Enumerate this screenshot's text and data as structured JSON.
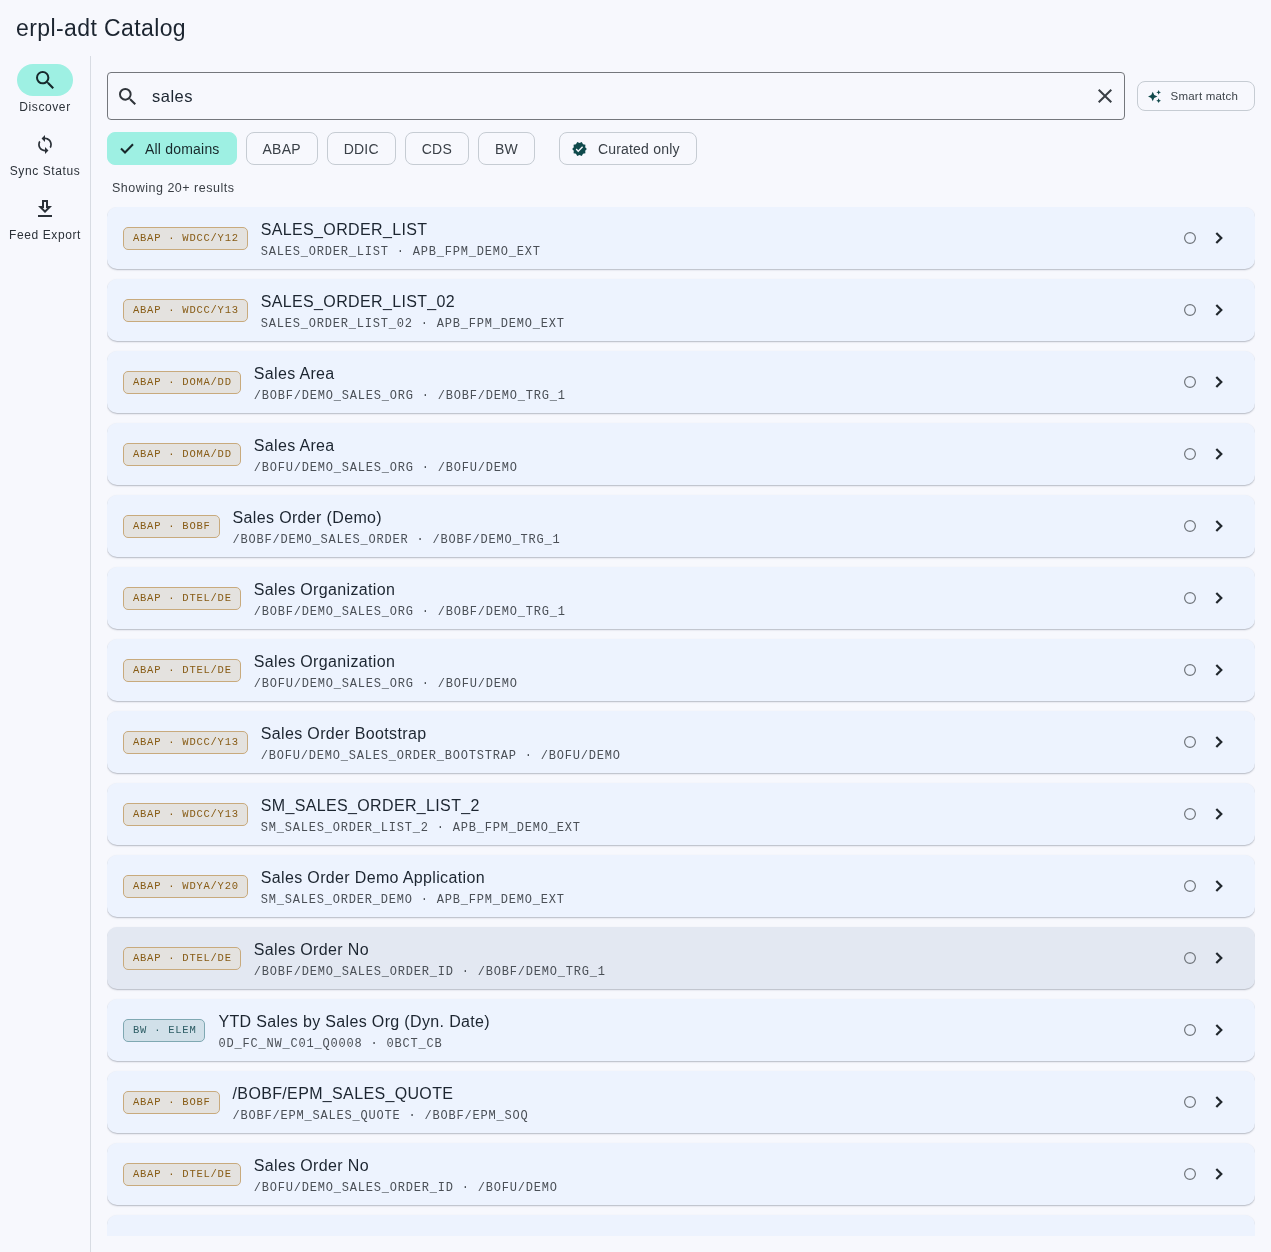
{
  "app": {
    "title": "erpl-adt Catalog"
  },
  "nav": [
    {
      "label": "Discover",
      "selected": true
    },
    {
      "label": "Sync Status",
      "selected": false
    },
    {
      "label": "Feed Export",
      "selected": false
    }
  ],
  "search": {
    "value": "sales"
  },
  "smart_match": {
    "label": "Smart match"
  },
  "filters": [
    {
      "label": "All domains",
      "selected": true
    },
    {
      "label": "ABAP",
      "selected": false
    },
    {
      "label": "DDIC",
      "selected": false
    },
    {
      "label": "CDS",
      "selected": false
    },
    {
      "label": "BW",
      "selected": false
    }
  ],
  "curated": {
    "label": "Curated only",
    "on": false
  },
  "result_count": "Showing 20+ results",
  "results": [
    {
      "badge": {
        "text": "ABAP · WDCC/Y12",
        "kind": "abap"
      },
      "title": "SALES_ORDER_LIST",
      "subtitle": "SALES_ORDER_LIST · APB_FPM_DEMO_EXT",
      "highlighted": false
    },
    {
      "badge": {
        "text": "ABAP · WDCC/Y13",
        "kind": "abap"
      },
      "title": "SALES_ORDER_LIST_02",
      "subtitle": "SALES_ORDER_LIST_02 · APB_FPM_DEMO_EXT",
      "highlighted": false
    },
    {
      "badge": {
        "text": "ABAP · DOMA/DD",
        "kind": "abap"
      },
      "title": "Sales Area",
      "subtitle": "/BOBF/DEMO_SALES_ORG · /BOBF/DEMO_TRG_1",
      "highlighted": false
    },
    {
      "badge": {
        "text": "ABAP · DOMA/DD",
        "kind": "abap"
      },
      "title": "Sales Area",
      "subtitle": "/BOFU/DEMO_SALES_ORG · /BOFU/DEMO",
      "highlighted": false
    },
    {
      "badge": {
        "text": "ABAP · BOBF",
        "kind": "abap"
      },
      "title": "Sales Order (Demo)",
      "subtitle": "/BOBF/DEMO_SALES_ORDER · /BOBF/DEMO_TRG_1",
      "highlighted": false
    },
    {
      "badge": {
        "text": "ABAP · DTEL/DE",
        "kind": "abap"
      },
      "title": "Sales Organization",
      "subtitle": "/BOBF/DEMO_SALES_ORG · /BOBF/DEMO_TRG_1",
      "highlighted": false
    },
    {
      "badge": {
        "text": "ABAP · DTEL/DE",
        "kind": "abap"
      },
      "title": "Sales Organization",
      "subtitle": "/BOFU/DEMO_SALES_ORG · /BOFU/DEMO",
      "highlighted": false
    },
    {
      "badge": {
        "text": "ABAP · WDCC/Y13",
        "kind": "abap"
      },
      "title": "Sales Order Bootstrap",
      "subtitle": "/BOFU/DEMO_SALES_ORDER_BOOTSTRAP · /BOFU/DEMO",
      "highlighted": false
    },
    {
      "badge": {
        "text": "ABAP · WDCC/Y13",
        "kind": "abap"
      },
      "title": "SM_SALES_ORDER_LIST_2",
      "subtitle": "SM_SALES_ORDER_LIST_2 · APB_FPM_DEMO_EXT",
      "highlighted": false
    },
    {
      "badge": {
        "text": "ABAP · WDYA/Y20",
        "kind": "abap"
      },
      "title": "Sales Order Demo Application",
      "subtitle": "SM_SALES_ORDER_DEMO · APB_FPM_DEMO_EXT",
      "highlighted": false
    },
    {
      "badge": {
        "text": "ABAP · DTEL/DE",
        "kind": "abap"
      },
      "title": "Sales Order No",
      "subtitle": "/BOBF/DEMO_SALES_ORDER_ID · /BOBF/DEMO_TRG_1",
      "highlighted": true
    },
    {
      "badge": {
        "text": "BW · ELEM",
        "kind": "bw"
      },
      "title": "YTD Sales by Sales Org (Dyn. Date)",
      "subtitle": "0D_FC_NW_C01_Q0008 · 0BCT_CB",
      "highlighted": false
    },
    {
      "badge": {
        "text": "ABAP · BOBF",
        "kind": "abap"
      },
      "title": "/BOBF/EPM_SALES_QUOTE",
      "subtitle": "/BOBF/EPM_SALES_QUOTE · /BOBF/EPM_SOQ",
      "highlighted": false
    },
    {
      "badge": {
        "text": "ABAP · DTEL/DE",
        "kind": "abap"
      },
      "title": "Sales Order No",
      "subtitle": "/BOFU/DEMO_SALES_ORDER_ID · /BOFU/DEMO",
      "highlighted": false
    },
    {
      "highlighted": false
    }
  ]
}
